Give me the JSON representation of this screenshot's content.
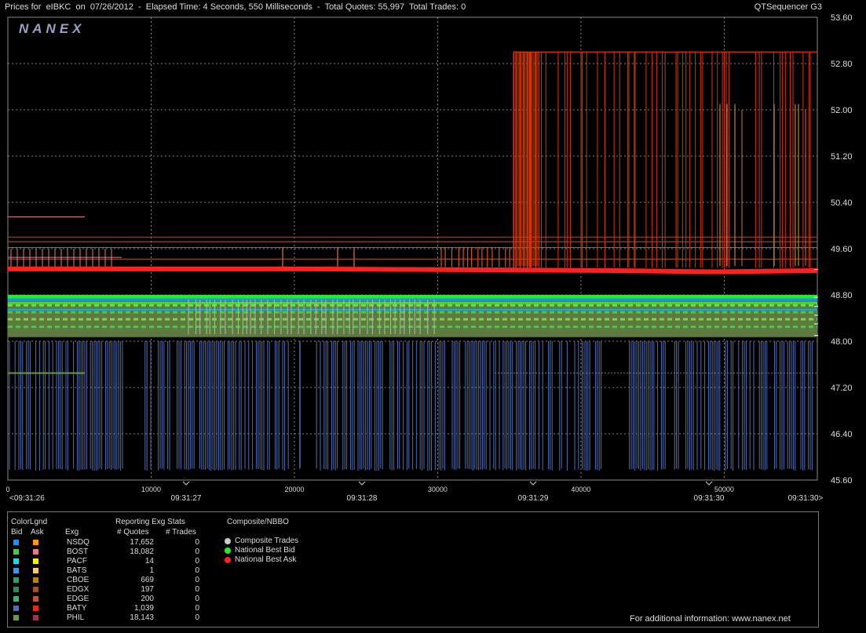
{
  "header": {
    "title": "Prices for  eIBKC  on  07/26/2012  -  Elapsed Time: 4 Seconds, 550 Milliseconds  -  Total Quotes: 55,997  Total Trades: 0",
    "app_name": "QTSequencer G3",
    "logo_text": "NANEX"
  },
  "chart_data": {
    "type": "line",
    "ylim": [
      45.6,
      53.6
    ],
    "y_ticks": [
      "53.60",
      "52.80",
      "52.00",
      "51.20",
      "50.40",
      "49.60",
      "48.80",
      "48.00",
      "47.20",
      "46.40",
      "45.60"
    ],
    "xlim": [
      0,
      56500
    ],
    "x_ticks": [
      "0",
      "10000",
      "20000",
      "30000",
      "40000",
      "50000"
    ],
    "time_ticks": [
      "<09:31:26",
      "09:31:27",
      "09:31:28",
      "09:31:29",
      "09:31:30",
      "09:31:30>"
    ],
    "grid": true,
    "series": [
      {
        "name": "National Best Ask",
        "color": "#ff2020",
        "values": [
          49.25,
          49.25,
          49.25,
          49.25,
          49.24,
          49.23,
          49.22,
          49.2,
          49.22
        ]
      },
      {
        "name": "National Best Bid",
        "color": "#22ee22",
        "values": [
          48.77,
          48.77,
          48.76,
          48.76,
          48.75,
          48.75,
          48.76,
          48.76,
          48.76
        ]
      }
    ],
    "annotations": {
      "baty_ask_high": 53.0,
      "baty_spike_start_x": 35300,
      "phil_bid_low": 48.0,
      "phil_bid_floor": 45.8
    }
  },
  "legend": {
    "colorlgnd_label": "ColorLgnd",
    "bid_label": "Bid",
    "ask_label": "Ask",
    "exg_label": "Exg",
    "stats_title": "Reporting Exg Stats",
    "quotes_label": "# Quotes",
    "trades_label": "# Trades",
    "composite_title": "Composite/NBBO",
    "rows": [
      {
        "exg": "NSDQ",
        "quotes": "17,652",
        "trades": "0",
        "bid": "#1e8fff",
        "ask": "#ff9900"
      },
      {
        "exg": "BOST",
        "quotes": "18,082",
        "trades": "0",
        "bid": "#44cc44",
        "ask": "#e07c8c"
      },
      {
        "exg": "PACF",
        "quotes": "14",
        "trades": "0",
        "bid": "#00e5ff",
        "ask": "#ffee00"
      },
      {
        "exg": "BATS",
        "quotes": "1",
        "trades": "0",
        "bid": "#3399ff",
        "ask": "#ffcc66"
      },
      {
        "exg": "CBOE",
        "quotes": "669",
        "trades": "0",
        "bid": "#2f9e6f",
        "ask": "#b8860b"
      },
      {
        "exg": "EDGX",
        "quotes": "197",
        "trades": "0",
        "bid": "#2e8b57",
        "ask": "#a0522d"
      },
      {
        "exg": "EDGE",
        "quotes": "200",
        "trades": "0",
        "bid": "#3cb371",
        "ask": "#b85a3a"
      },
      {
        "exg": "BATY",
        "quotes": "1,039",
        "trades": "0",
        "bid": "#4a6fb5",
        "ask": "#dd3300"
      },
      {
        "exg": "PHIL",
        "quotes": "18,143",
        "trades": "0",
        "bid": "#6b9a3a",
        "ask": "#a0305a"
      }
    ],
    "composite_items": [
      {
        "label": "Composite Trades",
        "color": "#cccccc"
      },
      {
        "label": "National Best Bid",
        "color": "#22ee22"
      },
      {
        "label": "National Best Ask",
        "color": "#ff2020"
      }
    ],
    "footer": "For additional information: www.nanex.net"
  }
}
